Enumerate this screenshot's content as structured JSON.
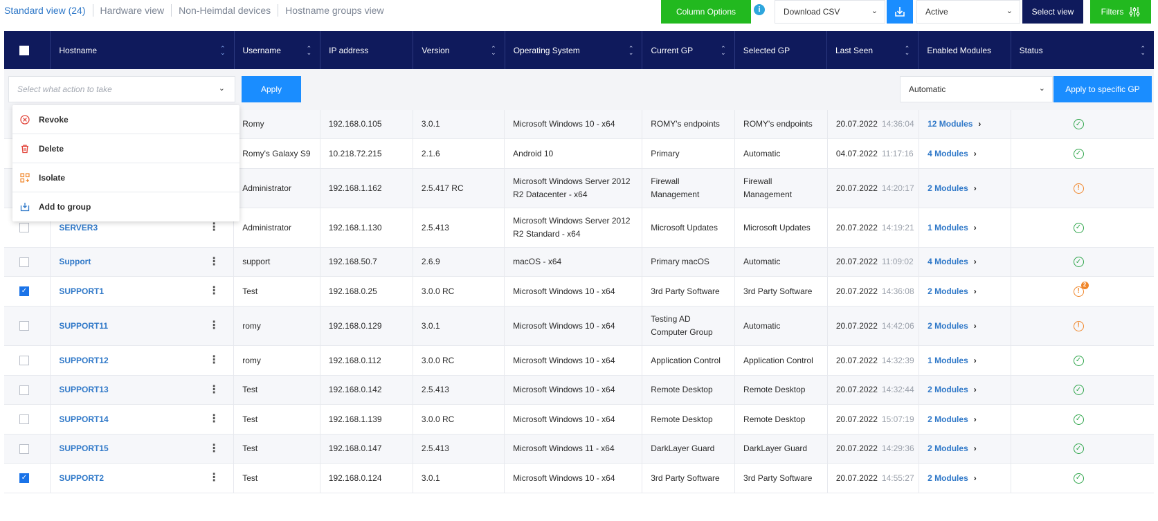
{
  "tabs": [
    {
      "label": "Standard view (24)",
      "active": true
    },
    {
      "label": "Hardware view",
      "active": false
    },
    {
      "label": "Non-Heimdal devices",
      "active": false
    },
    {
      "label": "Hostname groups view",
      "active": false
    }
  ],
  "toolbar": {
    "column_options": "Column Options",
    "info": "i",
    "download": "Download CSV",
    "status_filter": "Active",
    "select_view": "Select view",
    "filters": "Filters"
  },
  "columns": [
    "Hostname",
    "Username",
    "IP address",
    "Version",
    "Operating System",
    "Current GP",
    "Selected GP",
    "Last Seen",
    "Enabled Modules",
    "Status"
  ],
  "action": {
    "placeholder": "Select what action to take",
    "apply": "Apply",
    "gp_select": "Automatic",
    "apply_gp": "Apply to specific GP"
  },
  "menu": [
    {
      "label": "Revoke",
      "icon": "revoke-icon"
    },
    {
      "label": "Delete",
      "icon": "trash-icon"
    },
    {
      "label": "Isolate",
      "icon": "isolate-icon"
    },
    {
      "label": "Add to group",
      "icon": "add-to-group-icon"
    }
  ],
  "rows": [
    {
      "checked": false,
      "hostname": "",
      "username": "Romy",
      "ip": "192.168.0.105",
      "version": "3.0.1",
      "os": "Microsoft Windows 10 - x64",
      "current_gp": "ROMY's endpoints",
      "selected_gp": "ROMY's endpoints",
      "date": "20.07.2022",
      "time": "14:36:04",
      "modules": "12 Modules",
      "status": "ok"
    },
    {
      "checked": false,
      "hostname": "",
      "username": "Romy's Galaxy S9",
      "ip": "10.218.72.215",
      "version": "2.1.6",
      "os": "Android 10",
      "current_gp": "Primary",
      "selected_gp": "Automatic",
      "date": "04.07.2022",
      "time": "11:17:16",
      "modules": "4 Modules",
      "status": "ok"
    },
    {
      "checked": false,
      "hostname": "",
      "username": "Administrator",
      "ip": "192.168.1.162",
      "version": "2.5.417 RC",
      "os": "Microsoft Windows Server 2012 R2 Datacenter - x64",
      "current_gp": "Firewall Management",
      "selected_gp": "Firewall Management",
      "date": "20.07.2022",
      "time": "14:20:17",
      "modules": "2 Modules",
      "status": "warn"
    },
    {
      "checked": false,
      "hostname": "SERVER3",
      "username": "Administrator",
      "ip": "192.168.1.130",
      "version": "2.5.413",
      "os": "Microsoft Windows Server 2012 R2 Standard - x64",
      "current_gp": "Microsoft Updates",
      "selected_gp": "Microsoft Updates",
      "date": "20.07.2022",
      "time": "14:19:21",
      "modules": "1 Modules",
      "status": "ok"
    },
    {
      "checked": false,
      "hostname": "Support",
      "username": "support",
      "ip": "192.168.50.7",
      "version": "2.6.9",
      "os": "macOS - x64",
      "current_gp": "Primary macOS",
      "selected_gp": "Automatic",
      "date": "20.07.2022",
      "time": "11:09:02",
      "modules": "4 Modules",
      "status": "ok"
    },
    {
      "checked": true,
      "hostname": "SUPPORT1",
      "username": "Test",
      "ip": "192.168.0.25",
      "version": "3.0.0 RC",
      "os": "Microsoft Windows 10 - x64",
      "current_gp": "3rd Party Software",
      "selected_gp": "3rd Party Software",
      "date": "20.07.2022",
      "time": "14:36:08",
      "modules": "2 Modules",
      "status": "warn",
      "badge": "2"
    },
    {
      "checked": false,
      "hostname": "SUPPORT11",
      "username": "romy",
      "ip": "192.168.0.129",
      "version": "3.0.1",
      "os": "Microsoft Windows 10 - x64",
      "current_gp": "Testing AD Computer Group",
      "selected_gp": "Automatic",
      "date": "20.07.2022",
      "time": "14:42:06",
      "modules": "2 Modules",
      "status": "warn"
    },
    {
      "checked": false,
      "hostname": "SUPPORT12",
      "username": "romy",
      "ip": "192.168.0.112",
      "version": "3.0.0 RC",
      "os": "Microsoft Windows 10 - x64",
      "current_gp": "Application Control",
      "selected_gp": "Application Control",
      "date": "20.07.2022",
      "time": "14:32:39",
      "modules": "1 Modules",
      "status": "ok"
    },
    {
      "checked": false,
      "hostname": "SUPPORT13",
      "username": "Test",
      "ip": "192.168.0.142",
      "version": "2.5.413",
      "os": "Microsoft Windows 10 - x64",
      "current_gp": "Remote Desktop",
      "selected_gp": "Remote Desktop",
      "date": "20.07.2022",
      "time": "14:32:44",
      "modules": "2 Modules",
      "status": "ok"
    },
    {
      "checked": false,
      "hostname": "SUPPORT14",
      "username": "Test",
      "ip": "192.168.1.139",
      "version": "3.0.0 RC",
      "os": "Microsoft Windows 10 - x64",
      "current_gp": "Remote Desktop",
      "selected_gp": "Remote Desktop",
      "date": "20.07.2022",
      "time": "15:07:19",
      "modules": "2 Modules",
      "status": "ok"
    },
    {
      "checked": false,
      "hostname": "SUPPORT15",
      "username": "Test",
      "ip": "192.168.0.147",
      "version": "2.5.413",
      "os": "Microsoft Windows 11 - x64",
      "current_gp": "DarkLayer Guard",
      "selected_gp": "DarkLayer Guard",
      "date": "20.07.2022",
      "time": "14:29:36",
      "modules": "2 Modules",
      "status": "ok"
    },
    {
      "checked": true,
      "hostname": "SUPPORT2",
      "username": "Test",
      "ip": "192.168.0.124",
      "version": "3.0.1",
      "os": "Microsoft Windows 10 - x64",
      "current_gp": "3rd Party Software",
      "selected_gp": "3rd Party Software",
      "date": "20.07.2022",
      "time": "14:55:27",
      "modules": "2 Modules",
      "status": "ok"
    }
  ],
  "colors": {
    "navy": "#0f1a5c",
    "green": "#22b91f",
    "blue": "#1a8dff",
    "link": "#2f78c8",
    "ok": "#2ea54a",
    "warn": "#f0862a"
  }
}
